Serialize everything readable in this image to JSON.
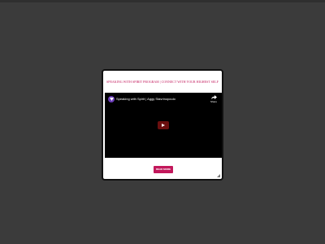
{
  "modal": {
    "heading": "Speaking with Spirit Program | Connect with your Highest Self",
    "read_more_label": "Read more",
    "video": {
      "title": "Speaking with Spirit | Aggy Stavrinopoulo",
      "share_label": "Share",
      "channel_icon": "channel-logo-icon",
      "play_icon": "play-icon"
    }
  },
  "colors": {
    "page_background": "#3b3b3b",
    "accent": "#c2185b",
    "video_background": "#000000",
    "play_button": "#6b0f0f"
  }
}
